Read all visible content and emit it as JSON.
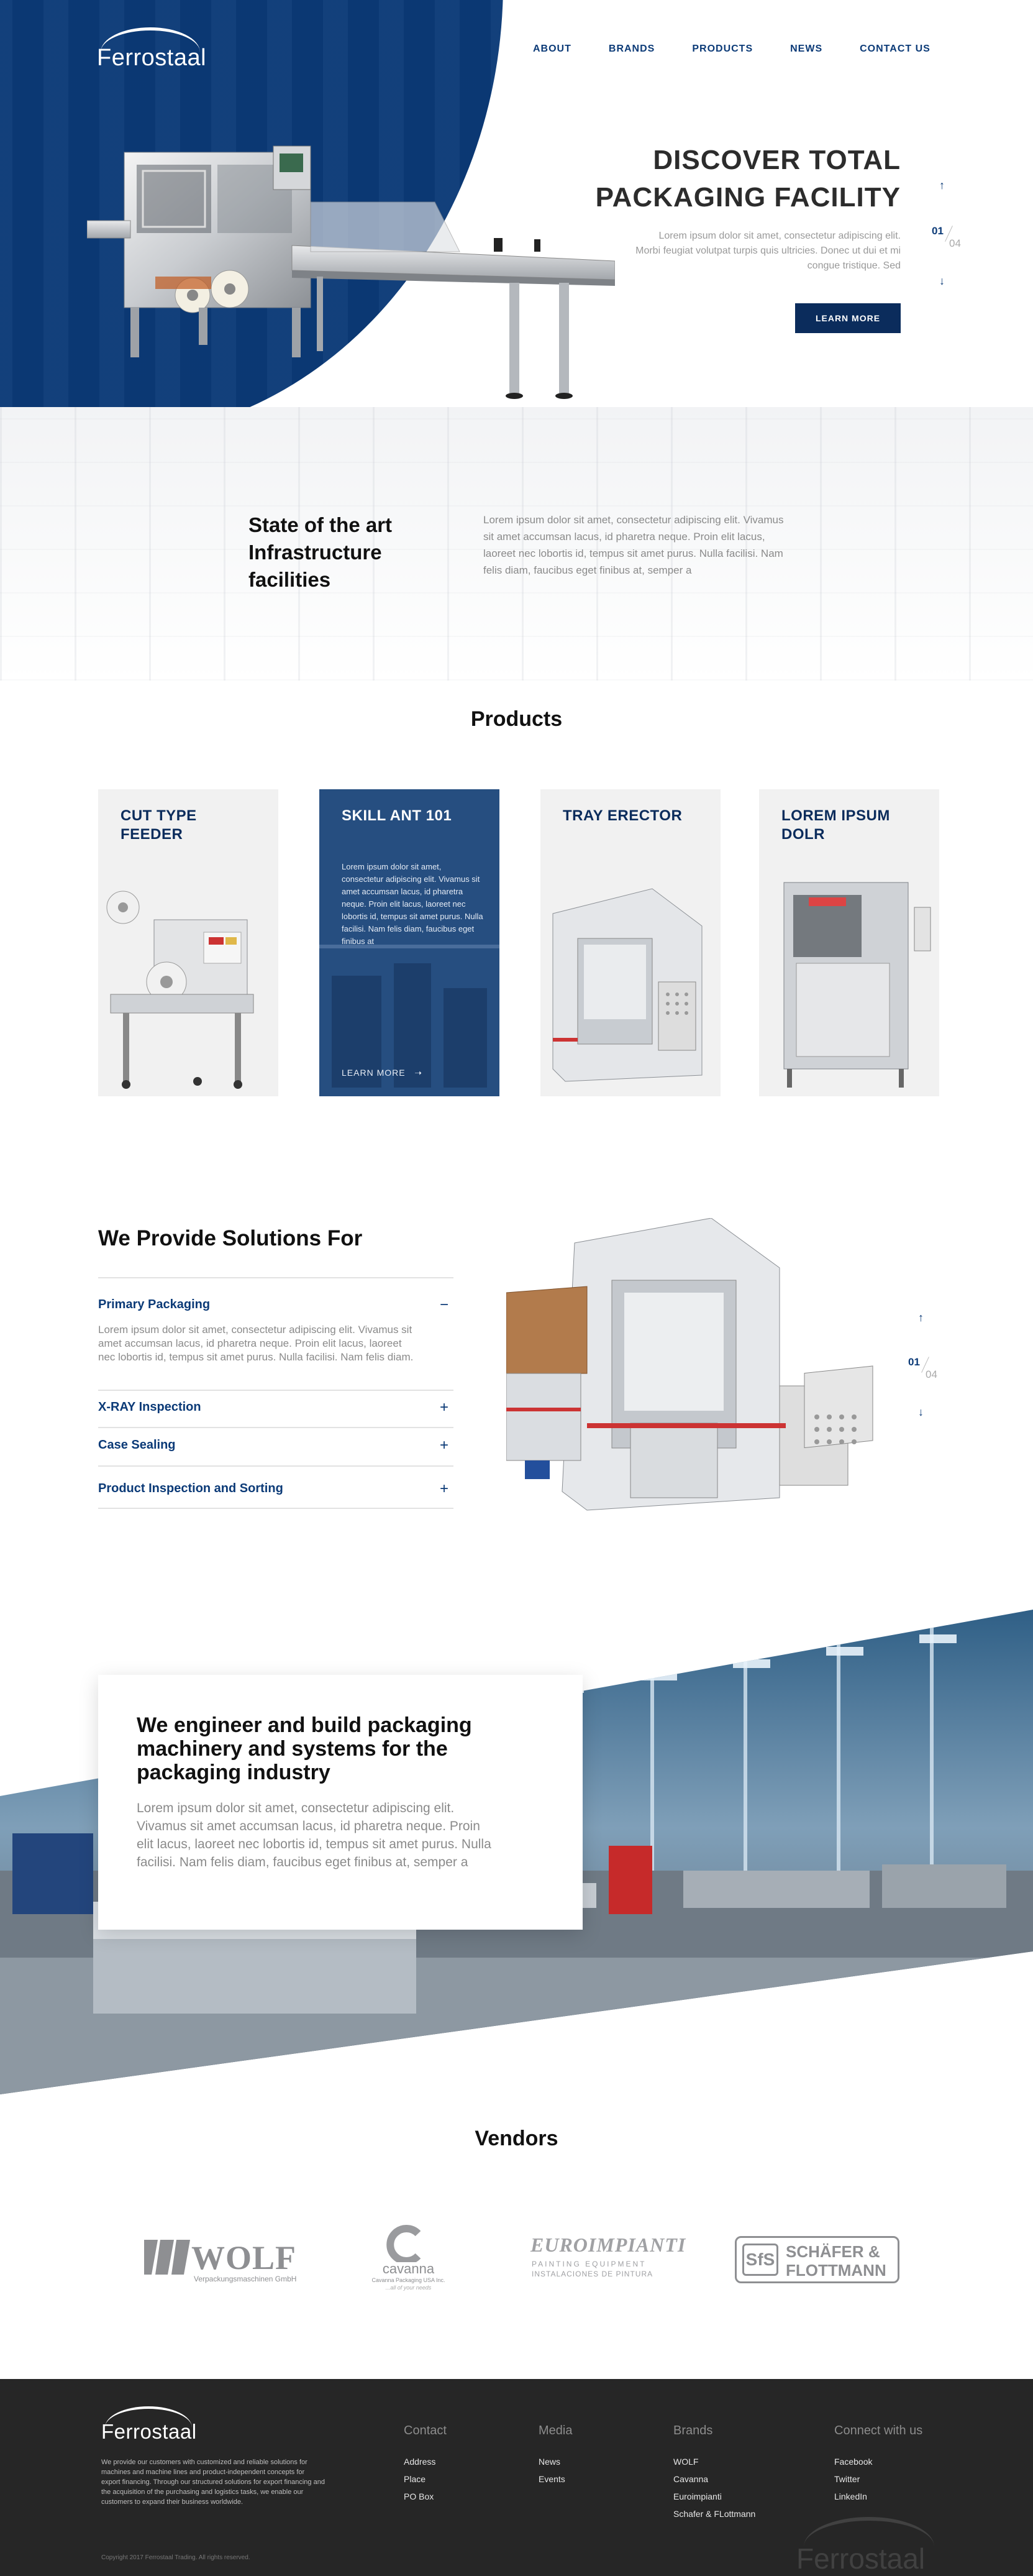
{
  "brand": {
    "name": "Ferrostaal",
    "primary": "#0b3a77",
    "dark": "#0b2c5c",
    "footer_bg": "#262626"
  },
  "nav": {
    "items": [
      "ABOUT",
      "BRANDS",
      "PRODUCTS",
      "NEWS",
      "CONTACT US"
    ]
  },
  "hero": {
    "title_line1": "DISCOVER TOTAL",
    "title_line2": "PACKAGING FACILITY",
    "text": "Lorem ipsum dolor sit amet, consectetur adipiscing elit. Morbi feugiat volutpat turpis quis ultricies. Donec ut dui et mi congue tristique. Sed",
    "button_label": "LEARN MORE",
    "slide_current": "01",
    "slide_total": "04",
    "up_icon": "arrow-up-icon",
    "down_icon": "arrow-down-icon"
  },
  "state": {
    "title": "State of the art Infrastructure facilities",
    "text": "Lorem ipsum dolor sit amet, consectetur adipiscing elit. Vivamus sit amet accumsan lacus, id pharetra neque. Proin elit lacus, laoreet nec lobortis id, tempus sit amet purus. Nulla facilisi. Nam felis diam, faucibus eget finibus at, semper a"
  },
  "products": {
    "title": "Products",
    "cards": [
      {
        "title": "CUT TYPE FEEDER"
      },
      {
        "title": "SKILL ANT 101",
        "text": "Lorem ipsum dolor sit amet, consectetur adipiscing elit. Vivamus sit amet accumsan lacus, id pharetra neque. Proin elit lacus, laoreet nec lobortis id, tempus sit amet purus. Nulla facilisi. Nam felis diam, faucibus eget finibus at",
        "link": "LEARN MORE"
      },
      {
        "title": "TRAY ERECTOR"
      },
      {
        "title": "LOREM IPSUM DOLR"
      }
    ],
    "link_arrow_icon": "arrow-right-icon"
  },
  "solutions": {
    "title": "We Provide Solutions For",
    "items": [
      {
        "label": "Primary Packaging",
        "icon": "−",
        "body": "Lorem ipsum dolor sit amet, consectetur adipiscing elit. Vivamus sit amet accumsan lacus, id pharetra neque. Proin elit lacus, laoreet nec lobortis id, tempus sit amet purus. Nulla facilisi. Nam felis diam."
      },
      {
        "label": "X-RAY Inspection",
        "icon": "+"
      },
      {
        "label": "Case Sealing",
        "icon": "+"
      },
      {
        "label": "Product Inspection and Sorting",
        "icon": "+"
      }
    ],
    "slide_current": "01",
    "slide_total": "04"
  },
  "engineer": {
    "title": "We engineer and build packaging machinery and systems for the packaging industry",
    "text": "Lorem ipsum dolor sit amet, consectetur adipiscing elit. Vivamus sit amet accumsan lacus, id pharetra neque. Proin elit lacus, laoreet nec lobortis id, tempus sit amet purus. Nulla facilisi. Nam felis diam, faucibus eget finibus at, semper a"
  },
  "vendors": {
    "title": "Vendors",
    "wolf": {
      "name": "WOLF",
      "sub": "Verpackungsmaschinen GmbH"
    },
    "cavanna": {
      "name": "cavanna",
      "sub": "Cavanna Packaging USA Inc.",
      "tag": "...all of your needs"
    },
    "euro": {
      "name": "EUROIMPIANTI",
      "line1": "PAINTING EQUIPMENT",
      "line2": "INSTALACIONES DE PINTURA"
    },
    "schafer": {
      "mark": "SfS",
      "line1": "SCHÄFER &",
      "line2": "FLOTTMANN"
    }
  },
  "footer": {
    "desc": "We provide our customers with customized and reliable solutions for machines and machine lines and product-independent concepts for export financing. Through our structured solutions for export financing and the acquisition of the purchasing and logistics tasks, we enable our customers to expand their business worldwide.",
    "copyright": "Copyright 2017 Ferrostaal Trading. All rights reserved.",
    "cols": [
      {
        "heading": "Contact",
        "links": [
          "Address",
          "Place",
          "PO Box"
        ]
      },
      {
        "heading": "Media",
        "links": [
          "News",
          "Events"
        ]
      },
      {
        "heading": "Brands",
        "links": [
          "WOLF",
          "Cavanna",
          "Euroimpianti",
          "Schafer & FLottmann"
        ]
      },
      {
        "heading": "Connect with us",
        "links": [
          "Facebook",
          "Twitter",
          "LinkedIn"
        ]
      }
    ]
  }
}
